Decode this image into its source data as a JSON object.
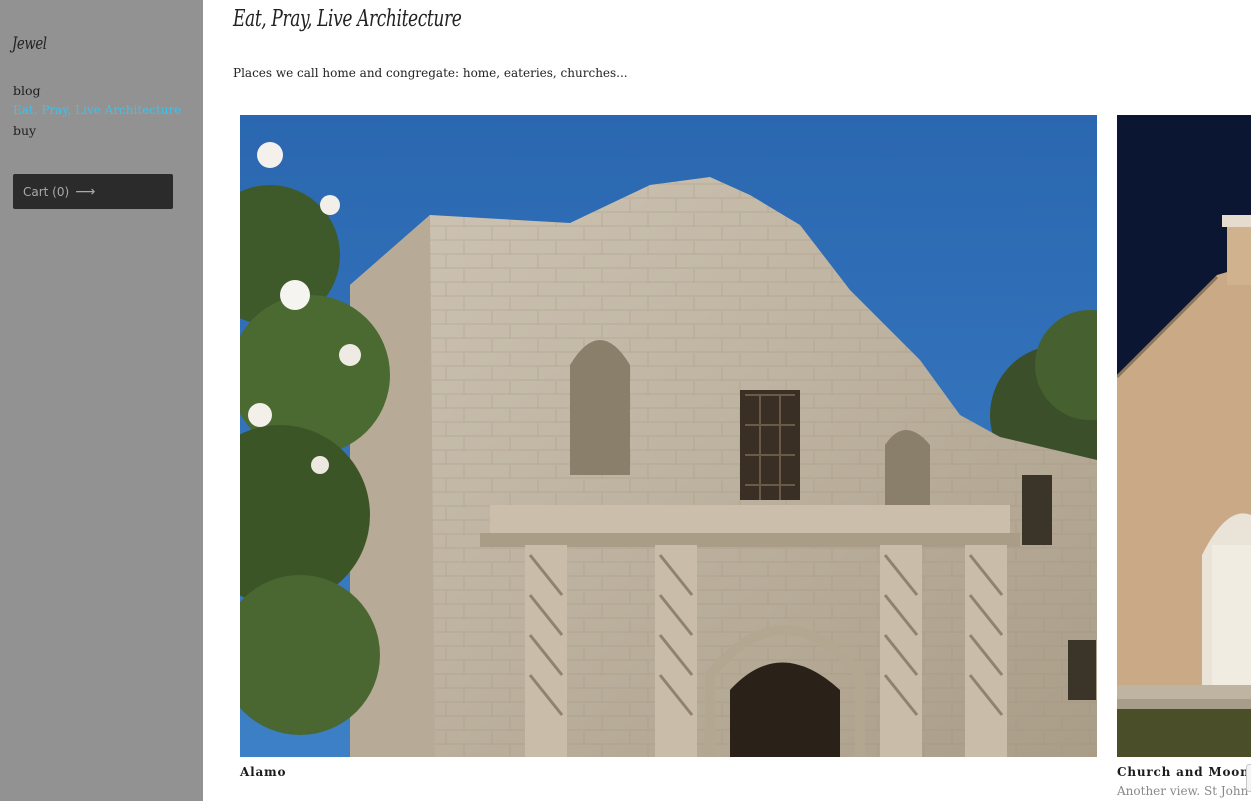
{
  "sidebar": {
    "site_title": "Jewel",
    "nav": {
      "blog": "blog",
      "eat_pray_live": "Eat, Pray, Live Architecture",
      "buy": "buy"
    },
    "cart_label": "Cart (0)",
    "cart_arrow": "⟶"
  },
  "main": {
    "title": "Eat, Pray, Live Architecture",
    "description": "Places we call home and congregate: home, eateries, churches...",
    "photos": [
      {
        "caption": "Alamo",
        "image_icon": "alamo-facade-photo"
      },
      {
        "caption": "Church and Moon",
        "subcaption": "Another view. St John",
        "image_icon": "church-photo"
      }
    ]
  },
  "colors": {
    "sidebar_bg": "#929293",
    "active_link": "#3ec2ea",
    "cart_bg": "#2b2b2b",
    "sky": "#2d6bb5"
  }
}
